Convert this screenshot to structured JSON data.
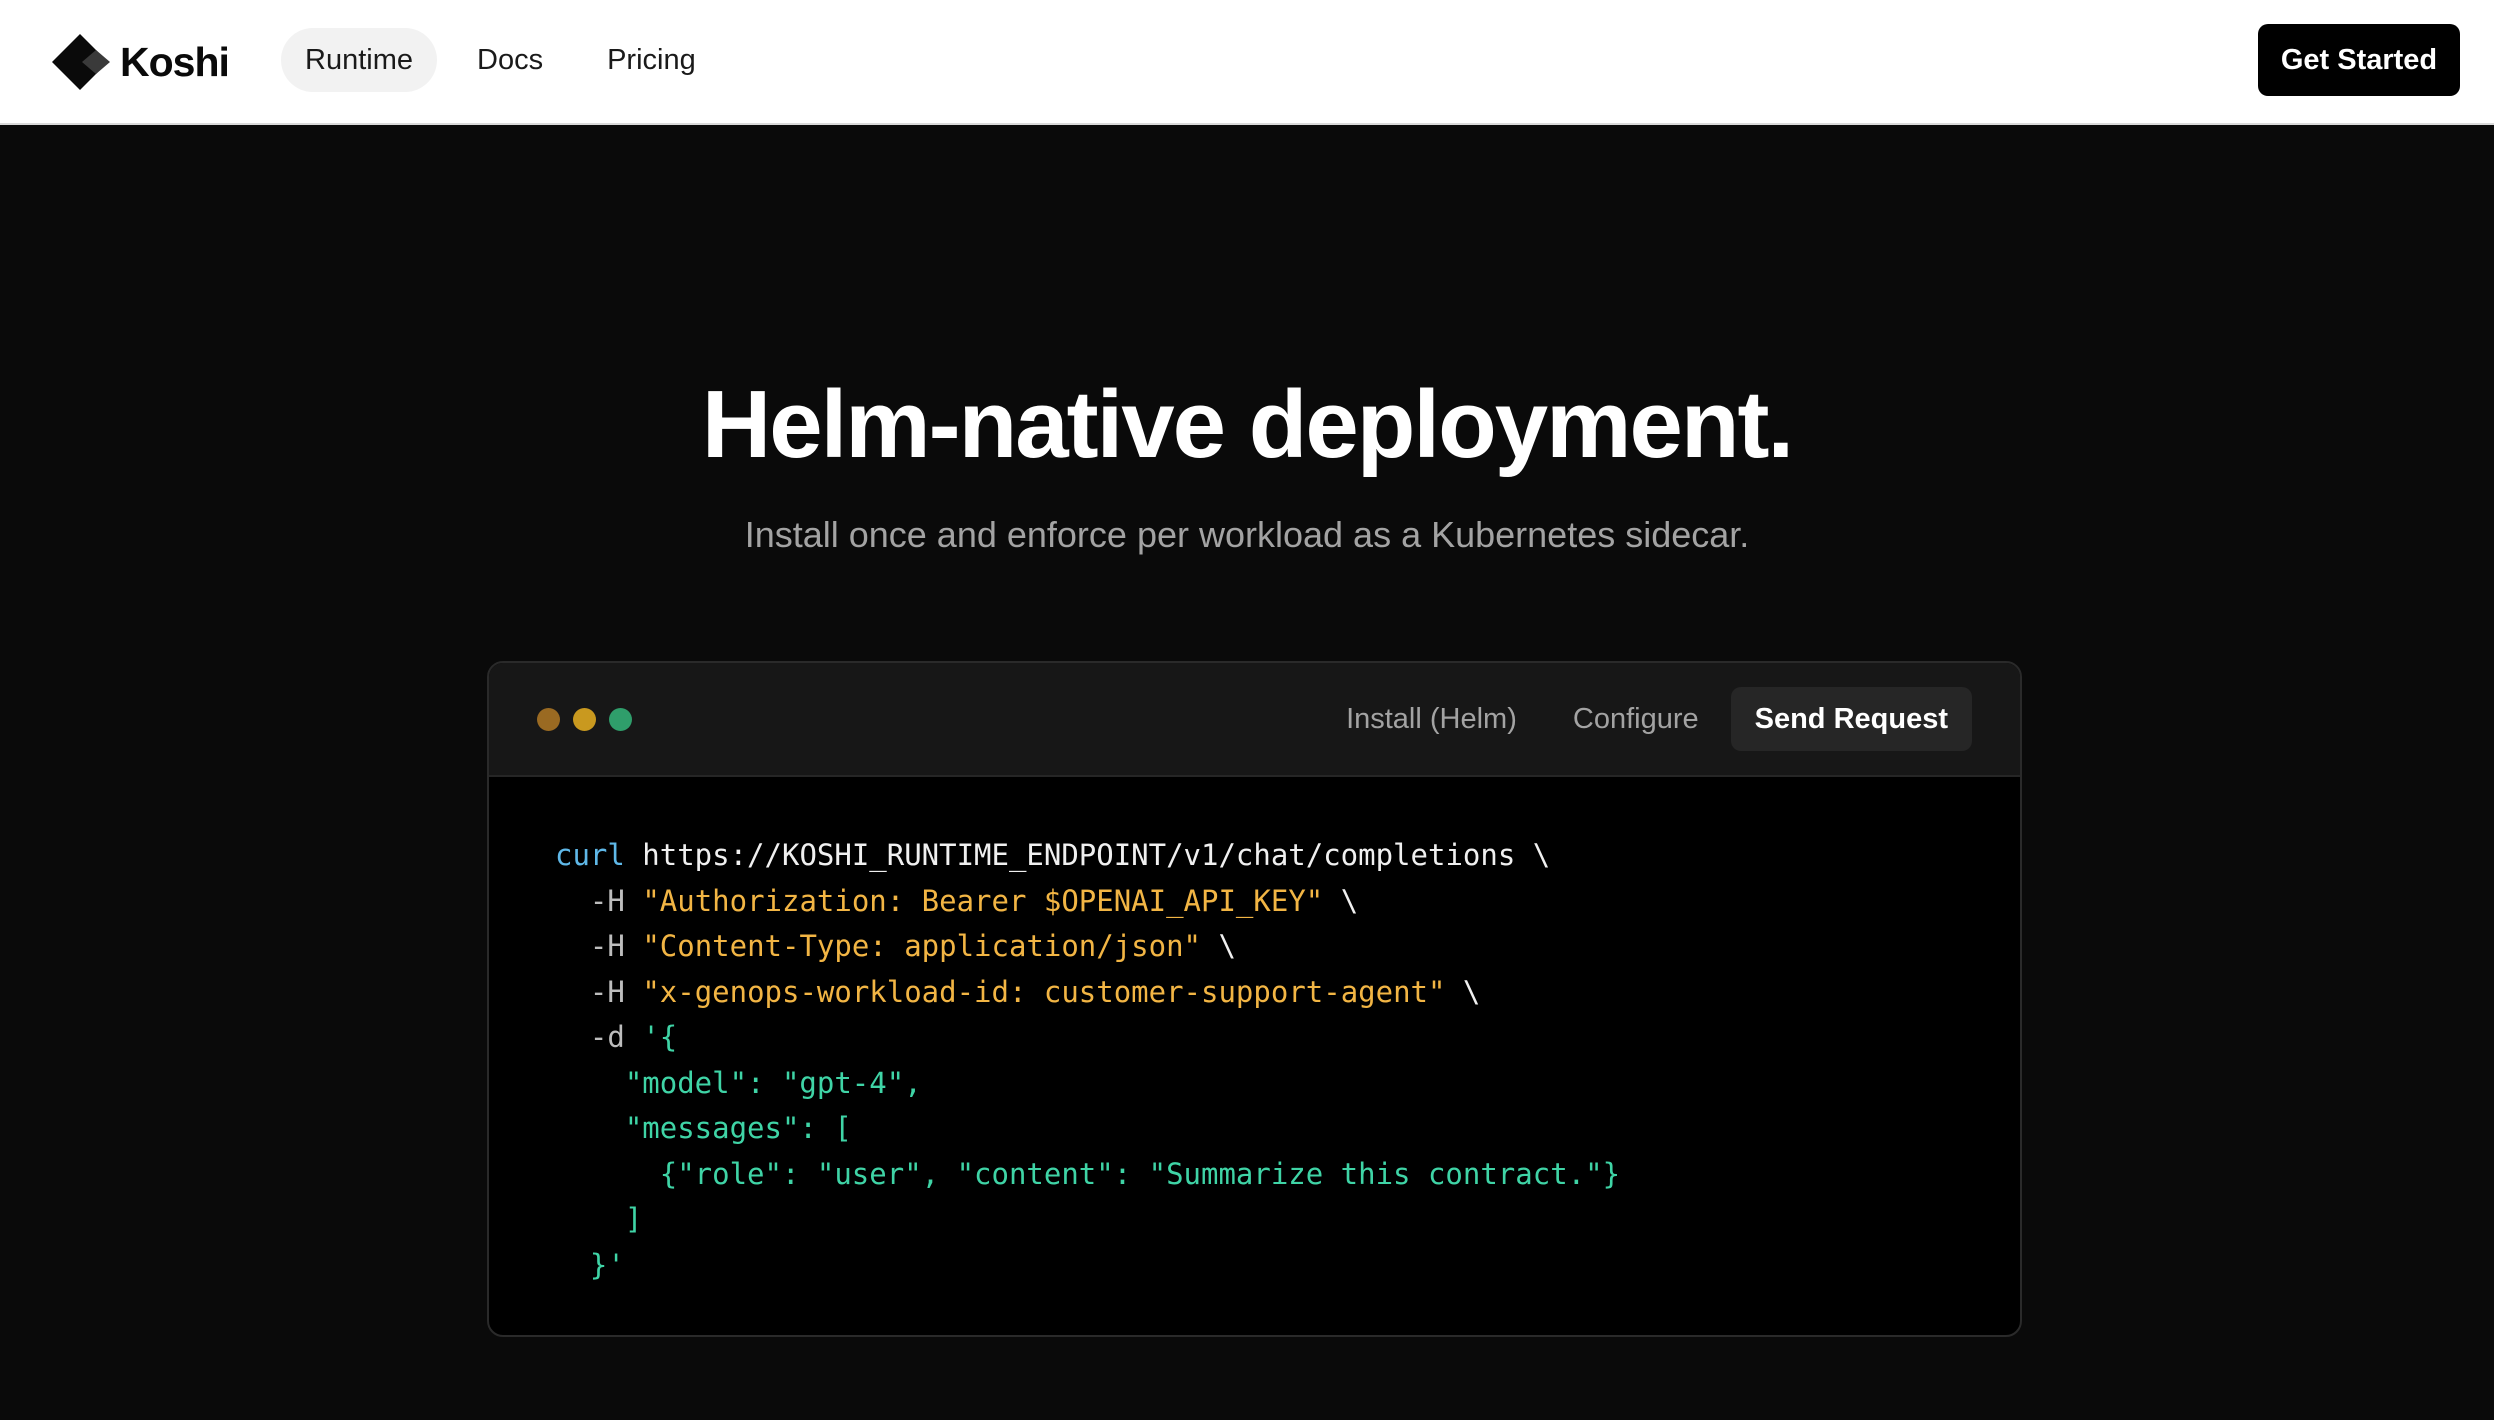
{
  "nav": {
    "brand": "Koshi",
    "links": [
      {
        "label": "Runtime",
        "active": true
      },
      {
        "label": "Docs",
        "active": false
      },
      {
        "label": "Pricing",
        "active": false
      }
    ],
    "cta_label": "Get Started"
  },
  "hero": {
    "title": "Helm-native deployment.",
    "subtitle": "Install once and enforce per workload as a Kubernetes sidecar."
  },
  "terminal": {
    "dot_colors": [
      "#9a6a22",
      "#c9991f",
      "#2f9e6b"
    ],
    "tabs": [
      {
        "label": "Install (Helm)",
        "active": false
      },
      {
        "label": "Configure",
        "active": false
      },
      {
        "label": "Send Request",
        "active": true
      }
    ],
    "code": {
      "line1": {
        "cmd": "curl",
        "url": " https://KOSHI_RUNTIME_ENDPOINT/v1/chat/completions \\"
      },
      "line2": {
        "flag": "  -H ",
        "str": "\"Authorization: Bearer $OPENAI_API_KEY\"",
        "tail": " \\"
      },
      "line3": {
        "flag": "  -H ",
        "str": "\"Content-Type: application/json\"",
        "tail": " \\"
      },
      "line4": {
        "flag": "  -H ",
        "str": "\"x-genops-workload-id: customer-support-agent\"",
        "tail": " \\"
      },
      "line5": {
        "flag": "  -d ",
        "json": "'{"
      },
      "line6": "    \"model\": \"gpt-4\",",
      "line7": "    \"messages\": [",
      "line8": "      {\"role\": \"user\", \"content\": \"Summarize this contract.\"}",
      "line9": "    ]",
      "line10": "  }'"
    }
  },
  "colors": {
    "page_bg": "#0a0a0a",
    "cmd": "#5fb8e8",
    "string": "#f2b544",
    "json": "#3fd4a6"
  }
}
